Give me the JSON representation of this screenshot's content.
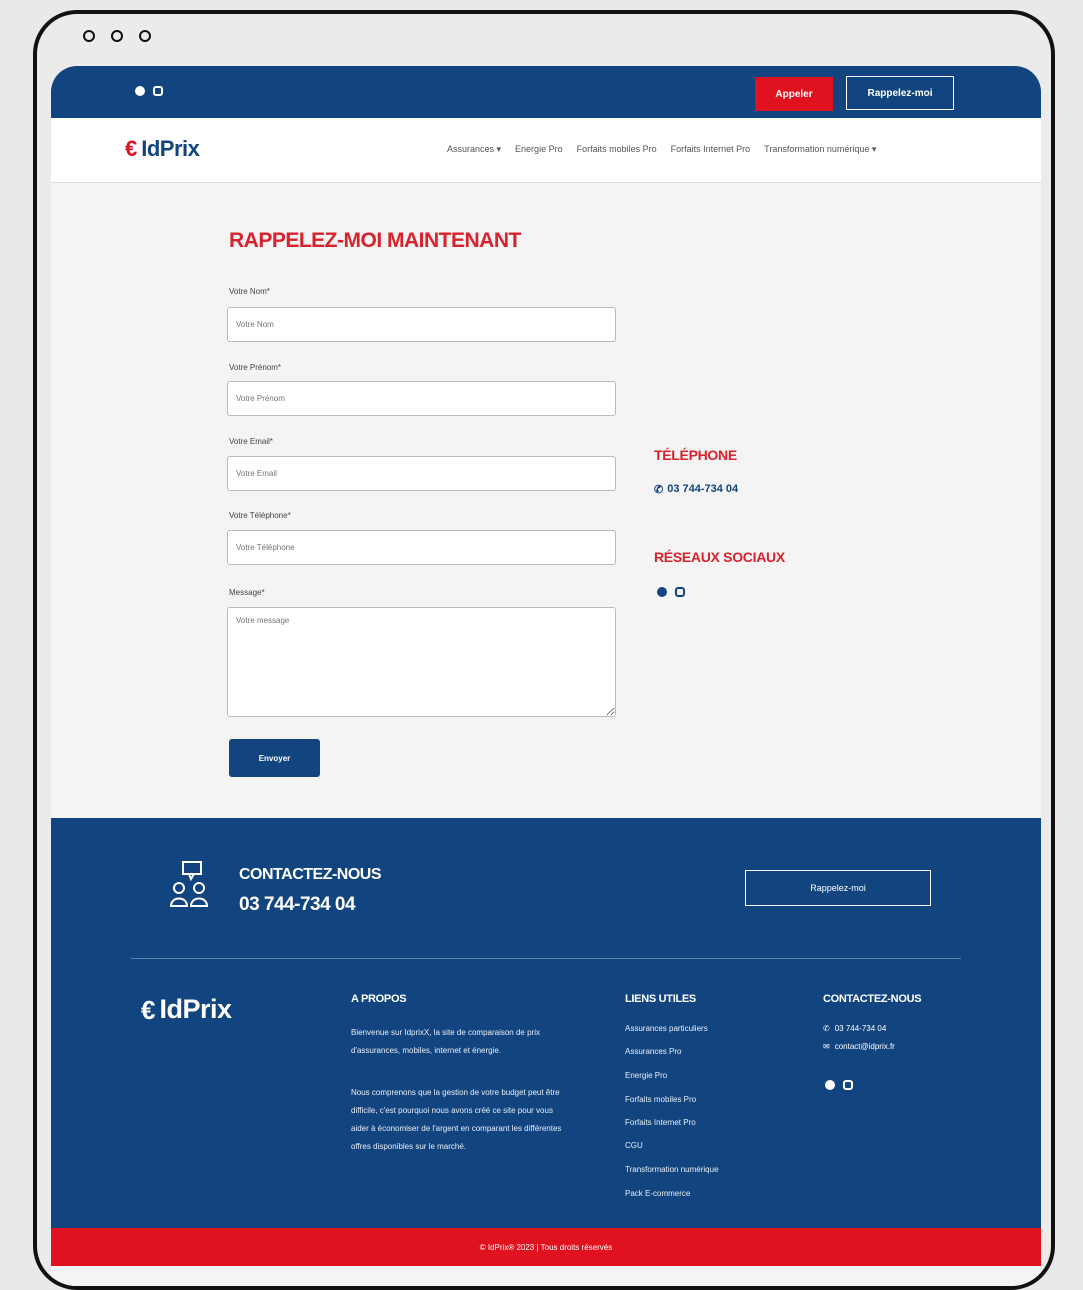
{
  "topbar": {
    "call_label": "Appeler",
    "recall_label": "Rappelez-moi"
  },
  "nav": {
    "logo_text": "IdPrix",
    "items": [
      "Assurances ▾",
      "Energie Pro",
      "Forfaits mobiles Pro",
      "Forfaits Internet Pro",
      "Transformation numérique ▾"
    ]
  },
  "form": {
    "title": "RAPPELEZ-MOI MAINTENANT",
    "fields": [
      {
        "label": "Votre Nom*",
        "placeholder": "Votre Nom"
      },
      {
        "label": "Votre Prénom*",
        "placeholder": "Votre Prénom"
      },
      {
        "label": "Votre Email*",
        "placeholder": "Votre Email"
      },
      {
        "label": "Votre Téléphone*",
        "placeholder": "Votre Téléphone"
      },
      {
        "label": "Message*",
        "placeholder": "Votre message"
      }
    ],
    "submit_label": "Envoyer"
  },
  "side": {
    "phone_title": "TÉLÉPHONE",
    "phone": "03 744-734 04",
    "social_title": "RÉSEAUX SOCIAUX"
  },
  "footer": {
    "contact_title": "CONTACTEZ-NOUS",
    "contact_phone": "03 744-734 04",
    "recall_label": "Rappelez-moi",
    "logo_text": "IdPrix",
    "about": {
      "title": "A PROPOS",
      "p1": "Bienvenue sur IdprixX, la site de comparaison de prix d'assurances, mobiles, internet et énergie.",
      "p2": "Nous comprenons que la gestion de votre budget peut être difficile, c'est pourquoi nous avons créé ce site pour vous aider à économiser de l'argent en comparant les différentes offres disponibles sur le marché."
    },
    "links": {
      "title": "LIENS UTILES",
      "items": [
        "Assurances particuliers",
        "Assurances Pro",
        "Energie Pro",
        "Forfaits mobiles Pro",
        "Forfaits Internet Pro",
        "CGU",
        "Transformation numérique",
        "Pack E-commerce"
      ]
    },
    "contact": {
      "title": "CONTACTEZ-NOUS",
      "phone": "03 744-734 04",
      "email": "contact@idprix.fr"
    },
    "copyright": "© IdPrix® 2023 | Tous droits réservés"
  },
  "icons": {
    "phone": "phone-icon",
    "facebook": "facebook-icon",
    "instagram": "instagram-icon",
    "chat": "chat-icon",
    "email": "email-icon"
  },
  "colors": {
    "brand_blue": "#12457f",
    "brand_red": "#e1121f",
    "title_red": "#d8222d"
  }
}
